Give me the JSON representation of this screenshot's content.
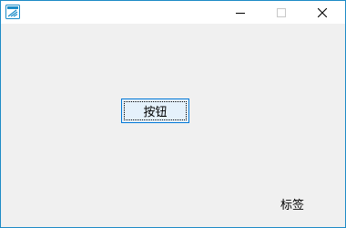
{
  "window": {
    "icon": "app-icon",
    "controls": {
      "minimize_icon": "minimize-icon",
      "maximize_icon": "maximize-icon",
      "close_icon": "close-icon"
    },
    "border_color": "#1c8ac6"
  },
  "form": {
    "button_label": "按钮",
    "label_text": "标签"
  }
}
